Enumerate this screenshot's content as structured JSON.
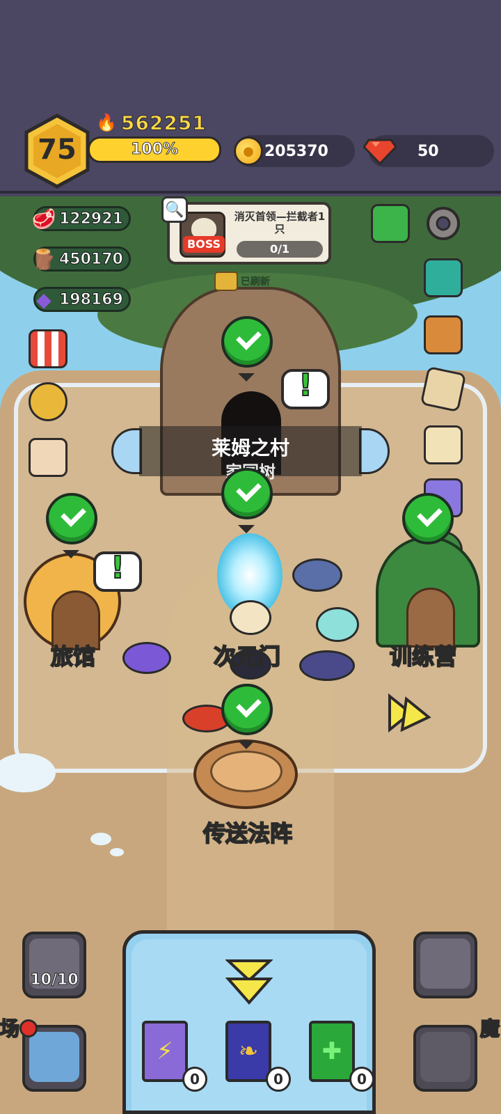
{
  "player": {
    "level": "75",
    "power": "562251",
    "exp_percent_label": "100%"
  },
  "currencies": {
    "gold": "205370",
    "gems": "50"
  },
  "resources": {
    "meat": "122921",
    "wood": "450170",
    "ore": "198169"
  },
  "boss_quest": {
    "badge": "BOSS",
    "title": "消灭首领—拦截者1只",
    "progress": "0/1"
  },
  "refresh_label": "已刷新",
  "village": {
    "name": "莱姆之村",
    "sub": "家园树"
  },
  "buildings": {
    "inn": "旅馆",
    "dimension_gate": "次元门",
    "training_camp": "训练营",
    "teleport_circle": "传送法阵"
  },
  "slimes": {
    "count": "10/10"
  },
  "edge_labels": {
    "left": "场",
    "right": "魔"
  },
  "books": {
    "lightning": "0",
    "wing": "0",
    "heal": "0"
  },
  "colors": {
    "topbar": "#4b4762",
    "accent_gold": "#ffd12e",
    "check_green": "#2fbb3a",
    "gem_red": "#e8442e"
  },
  "icons": [
    "fire-icon",
    "coin-icon",
    "gem-icon",
    "meat-icon",
    "wood-icon",
    "ore-icon",
    "search-icon",
    "skull-icon",
    "chest-icon",
    "quest-book-icon",
    "gear-icon",
    "mail-icon",
    "backpack-icon",
    "map-icon",
    "scroll-icon",
    "potion-icon",
    "tree-house-icon",
    "shop-icon",
    "medal-icon",
    "calendar-icon",
    "fast-forward-icon",
    "down-arrow-icon",
    "battle-icon",
    "portal-icon"
  ]
}
